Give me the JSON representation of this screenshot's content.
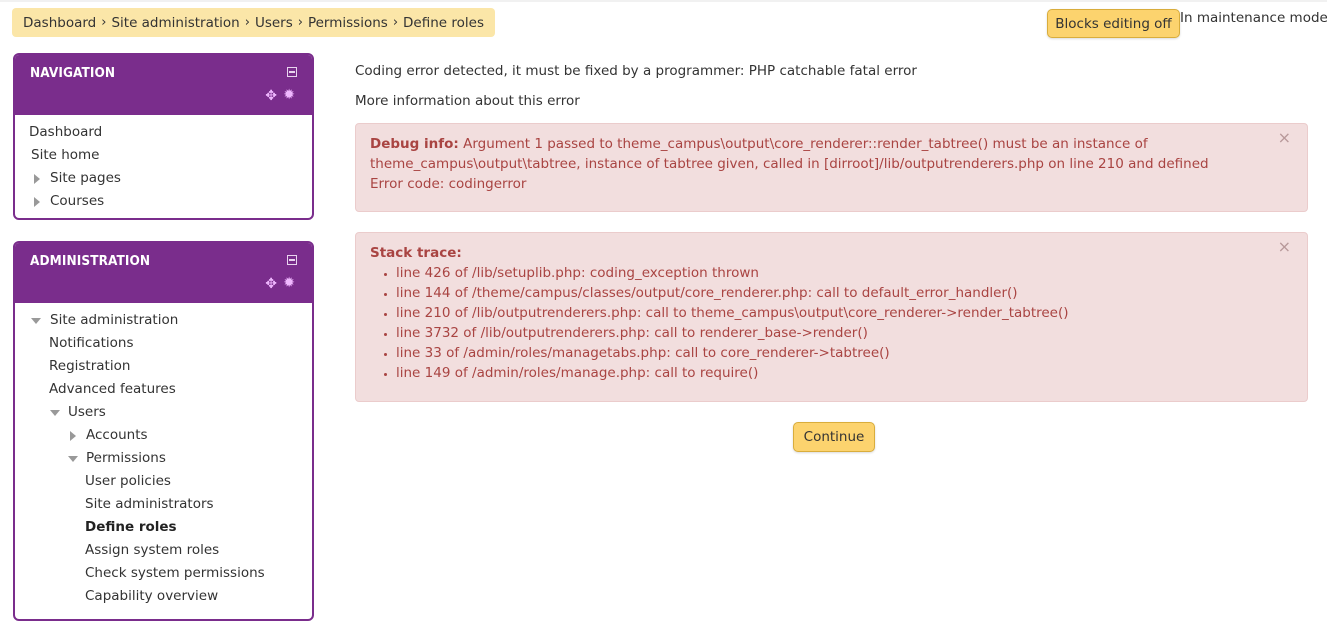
{
  "breadcrumb": {
    "items": [
      "Dashboard",
      "Site administration",
      "Users",
      "Permissions",
      "Define roles"
    ],
    "separator": "›"
  },
  "header": {
    "blocks_editing_label": "Blocks editing off",
    "maintenance_text": "In maintenance mode"
  },
  "navigation": {
    "title": "NAVIGATION",
    "items": [
      {
        "label": "Dashboard"
      },
      {
        "label": "Site home"
      },
      {
        "label": "Site pages"
      },
      {
        "label": "Courses"
      }
    ]
  },
  "administration": {
    "title": "ADMINISTRATION",
    "items": [
      {
        "label": "Site administration"
      },
      {
        "label": "Notifications"
      },
      {
        "label": "Registration"
      },
      {
        "label": "Advanced features"
      },
      {
        "label": "Users"
      },
      {
        "label": "Accounts"
      },
      {
        "label": "Permissions"
      },
      {
        "label": "User policies"
      },
      {
        "label": "Site administrators"
      },
      {
        "label": "Define roles"
      },
      {
        "label": "Assign system roles"
      },
      {
        "label": "Check system permissions"
      },
      {
        "label": "Capability overview"
      }
    ]
  },
  "main": {
    "error_title": "Coding error detected, it must be fixed by a programmer: PHP catchable fatal error",
    "more_info": "More information about this error",
    "debug": {
      "label": "Debug info:",
      "text": " Argument 1 passed to theme_campus\\output\\core_renderer::render_tabtree() must be an instance of theme_campus\\output\\tabtree, instance of tabtree given, called in [dirroot]/lib/outputrenderers.php on line 210 and defined",
      "error_code": "Error code: codingerror"
    },
    "stack": {
      "label": "Stack trace:",
      "lines": [
        "line 426 of /lib/setuplib.php: coding_exception thrown",
        "line 144 of /theme/campus/classes/output/core_renderer.php: call to default_error_handler()",
        "line 210 of /lib/outputrenderers.php: call to theme_campus\\output\\core_renderer->render_tabtree()",
        "line 3732 of /lib/outputrenderers.php: call to renderer_base->render()",
        "line 33 of /admin/roles/managetabs.php: call to core_renderer->tabtree()",
        "line 149 of /admin/roles/manage.php: call to require()"
      ]
    },
    "close_glyph": "×",
    "continue_label": "Continue"
  },
  "colors": {
    "brand_purple": "#7a2d8c",
    "breadcrumb_bg": "#fbe6a8",
    "button_yellow": "#fcd36e",
    "alert_bg": "#f2dede",
    "alert_text": "#a94442"
  },
  "icons": {
    "collapse": "minus-square-icon",
    "move": "move-arrows-icon",
    "settings": "gear-icon",
    "expand_closed": "triangle-right-icon",
    "expand_open": "triangle-down-icon"
  }
}
